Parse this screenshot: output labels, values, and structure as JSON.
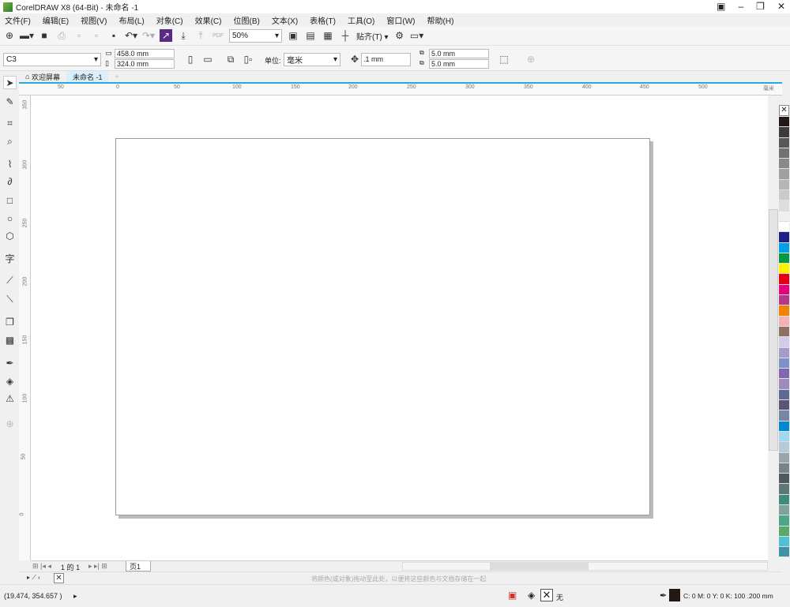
{
  "title": "CorelDRAW X8 (64-Bit) - 未命名 -1",
  "menu": [
    "文件(F)",
    "编辑(E)",
    "视图(V)",
    "布局(L)",
    "对象(C)",
    "效果(C)",
    "位图(B)",
    "文本(X)",
    "表格(T)",
    "工具(O)",
    "窗口(W)",
    "帮助(H)"
  ],
  "toolbar": {
    "zoom": "50%",
    "snap": "贴齐(T)"
  },
  "property_bar": {
    "paper_size": "C3",
    "width": "458.0 mm",
    "height": "324.0 mm",
    "units_label": "单位:",
    "units": "毫米",
    "nudge": ".1 mm",
    "dup_x": "5.0 mm",
    "dup_y": "5.0 mm"
  },
  "tabs": [
    {
      "label": "欢迎屏幕",
      "icon": "home-icon"
    },
    {
      "label": "未命名 -1",
      "active": true
    }
  ],
  "ruler": {
    "h_labels": [
      "50",
      "0",
      "50",
      "100",
      "150",
      "200",
      "250",
      "300",
      "350",
      "400",
      "450",
      "500"
    ],
    "unit": "毫米",
    "v_labels": [
      "350",
      "300",
      "250",
      "200",
      "150",
      "100",
      "50",
      "0"
    ]
  },
  "page_nav": {
    "current": "1",
    "of": "的",
    "total": "1",
    "page_tab": "页1"
  },
  "doc_palette_hint": "将颜色(或对象)拖动至此处，以便将这些颜色与文档存储在一起",
  "status": {
    "coords": "(19.474, 354.657 )",
    "fill": "无",
    "outline": "C: 0 M: 0 Y: 0 K: 100  .200 mm"
  },
  "palette": [
    "#231815",
    "#3e3a39",
    "#595757",
    "#727171",
    "#898989",
    "#9fa0a0",
    "#b5b5b6",
    "#c9caca",
    "#dcdddd",
    "#efefef",
    "#ffffff",
    "#1d2088",
    "#00a0e9",
    "#009944",
    "#fff100",
    "#e60012",
    "#e4007f",
    "#b5378a",
    "#f08300",
    "#f5b2b2",
    "#8c7164",
    "#d3cce6",
    "#a59aca",
    "#7f8fc8",
    "#8067b0",
    "#9d8bbd",
    "#5b6b94",
    "#5a5575",
    "#7586a6",
    "#0088d1",
    "#a0d8ef",
    "#b4ccd8",
    "#9aa4ab",
    "#7a8388",
    "#4e5a60",
    "#5c7a74",
    "#3f8a7a",
    "#7ea39d",
    "#4ea68a",
    "#5aa86a",
    "#4fc1d4",
    "#3e93a8"
  ],
  "accent": "#29a8e0"
}
